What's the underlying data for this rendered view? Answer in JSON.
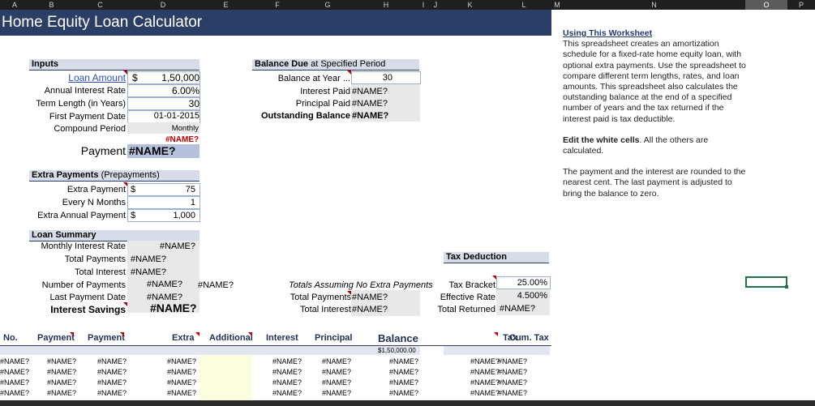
{
  "columns": [
    "A",
    "B",
    "C",
    "D",
    "E",
    "F",
    "G",
    "H",
    "I",
    "J",
    "K",
    "L",
    "M",
    "N",
    "O",
    "P"
  ],
  "title": "Home Equity Loan Calculator",
  "inputs": {
    "header": "Inputs",
    "loan_amount_label": "Loan Amount",
    "loan_amount_currency": "$",
    "loan_amount_value": "1,50,000",
    "rate_label": "Annual Interest Rate",
    "rate_value": "6.00%",
    "term_label": "Term Length (in Years)",
    "term_value": "30",
    "first_payment_label": "First Payment Date",
    "first_payment_value": "01-01-2015",
    "compound_label": "Compound Period",
    "compound_value": "Monthly",
    "error_value": "#NAME?",
    "payment_label": "Payment",
    "payment_value": "#NAME?"
  },
  "balance_due": {
    "header_bold": "Balance Due",
    "header_rest": " at Specified Period",
    "year_label": "Balance at Year ...",
    "year_value": "30",
    "interest_paid_label": "Interest Paid",
    "interest_paid_value": "#NAME?",
    "principal_paid_label": "Principal Paid",
    "principal_paid_value": "#NAME?",
    "outstanding_label": "Outstanding Balance",
    "outstanding_value": "#NAME?"
  },
  "extra": {
    "header_bold": "Extra Payments",
    "header_rest": " (Prepayments)",
    "extra_payment_label": "Extra Payment",
    "extra_payment_currency": "$",
    "extra_payment_value": "75",
    "every_n_label": "Every N Months",
    "every_n_value": "1",
    "annual_label": "Extra Annual Payment",
    "annual_currency": "$",
    "annual_value": "1,000"
  },
  "summary": {
    "header": "Loan Summary",
    "monthly_rate_label": "Monthly Interest Rate",
    "monthly_rate_value": "#NAME?",
    "total_payments_label": "Total Payments",
    "total_payments_value": "#NAME?",
    "total_interest_label": "Total Interest",
    "total_interest_value": "#NAME?",
    "num_payments_label": "Number of Payments",
    "num_payments_value": "#NAME?",
    "num_payments_extra": "#NAME?",
    "last_date_label": "Last Payment Date",
    "last_date_value": "#NAME?",
    "savings_label": "Interest Savings",
    "savings_value": "#NAME?",
    "no_extra_title": "Totals Assuming No Extra Payments",
    "no_extra_payments_label": "Total Payments",
    "no_extra_payments_value": "#NAME?",
    "no_extra_interest_label": "Total Interest",
    "no_extra_interest_value": "#NAME?"
  },
  "tax": {
    "header": "Tax Deduction",
    "bracket_label": "Tax Bracket",
    "bracket_value": "25.00%",
    "effective_label": "Effective Rate",
    "effective_value": "4.500%",
    "returned_label": "Total Returned",
    "returned_value": "#NAME?"
  },
  "schedule": {
    "headers": [
      "No.",
      "Payment",
      "Payment",
      "Extra",
      "Additional",
      "Interest",
      "Principal",
      "Balance",
      "Tax",
      "Cum. Tax"
    ],
    "start_balance": "$1,50,000.00",
    "cell": "#NAME?"
  },
  "notes": {
    "heading": "Using This Worksheet",
    "para1": "This spreadsheet creates an amortization schedule for a fixed-rate home equity loan, with optional extra payments. Use the spreadsheet to compare different term lengths, rates, and loan amounts. This spreadsheet also calculates the outstanding balance at the end of a specified number of years and the tax returned if the interest paid is tax deductible.",
    "edit_bold": "Edit the white cells",
    "edit_rest": ". All the others are calculated.",
    "para3": "The payment and the interest are rounded to the nearest cent. The last payment is adjusted to bring the balance to zero."
  },
  "colors": {
    "title_bg": "#2b3f66",
    "section_bg": "#d7dce8",
    "error": "#c00000",
    "link": "#2b4fb3",
    "selection": "#217346"
  }
}
